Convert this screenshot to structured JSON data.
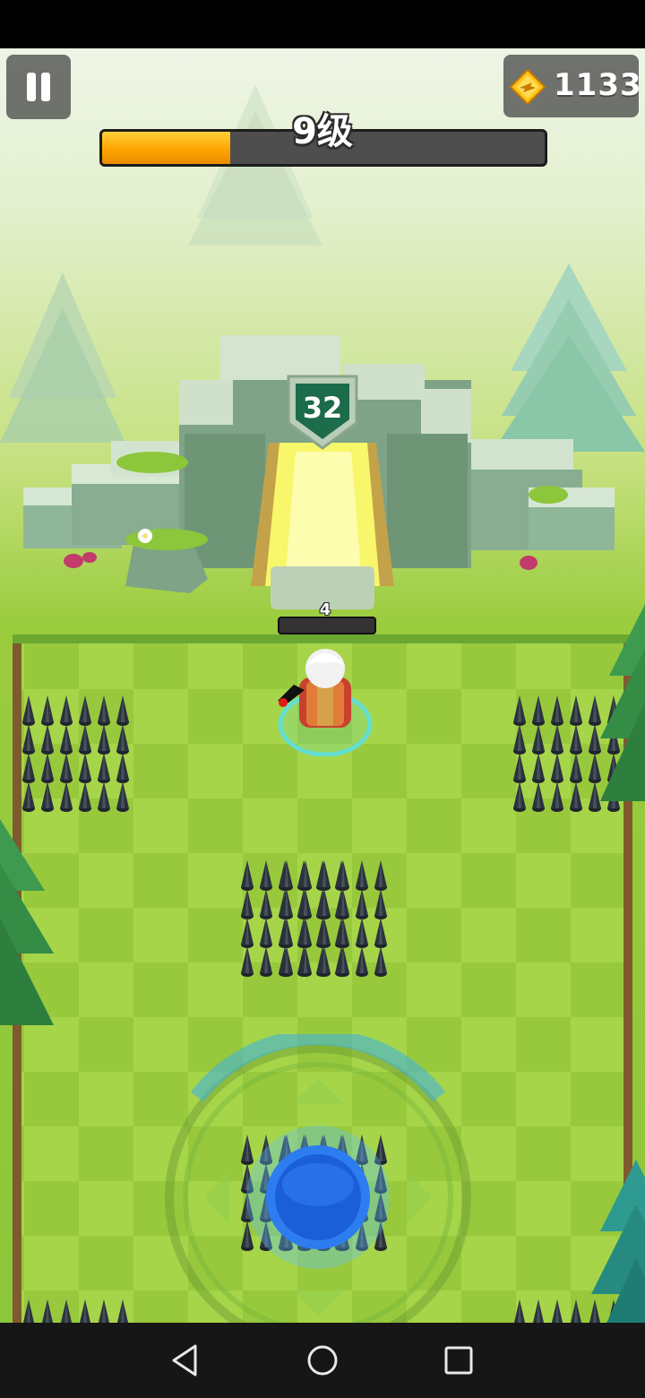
{
  "hud": {
    "pause_icon": "pause-icon",
    "gem_icon": "gem-icon",
    "gem_count": "1133",
    "level_label": "9级",
    "level_progress": 0.29
  },
  "gate": {
    "enemy_count": "32"
  },
  "player": {
    "hp_value": "4",
    "hp_fraction": 0
  },
  "joystick": {
    "icon": "joystick-icon"
  },
  "nav": {
    "back_icon": "back-icon",
    "home_icon": "home-icon",
    "recents_icon": "recents-icon"
  },
  "colors": {
    "progress_fill": "#ffa500",
    "grass_light": "#a6d54a",
    "grass_dark": "#98c93d",
    "joystick_knob": "#1a5fd8"
  }
}
